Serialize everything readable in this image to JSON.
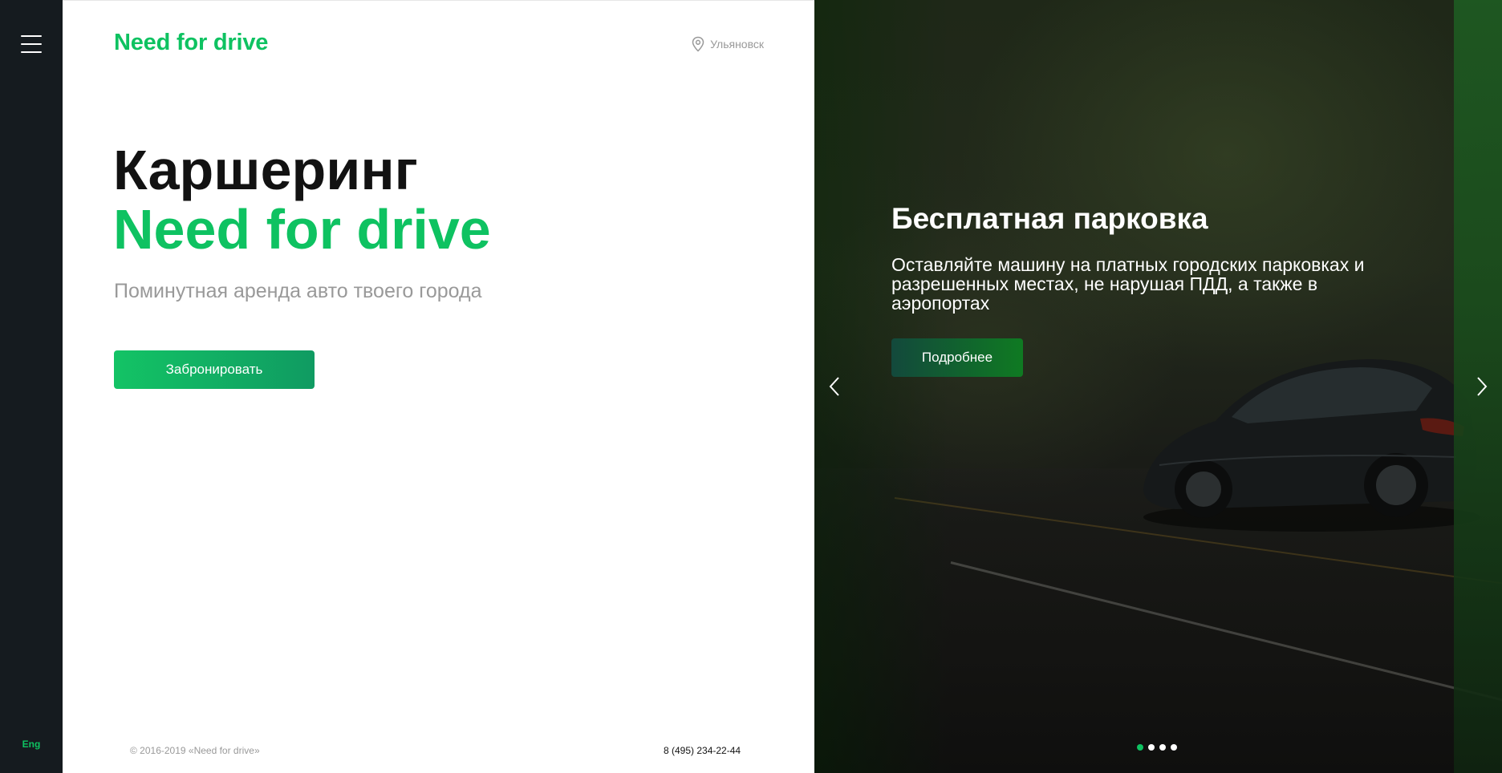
{
  "nav": {
    "menu_icon": "hamburger-menu-icon",
    "language": "Eng"
  },
  "header": {
    "brand": "Need for drive",
    "location_icon": "map-pin-icon",
    "city": "Ульяновск"
  },
  "hero": {
    "title": "Каршеринг",
    "brand": "Need for drive",
    "subtitle": "Поминутная аренда авто твоего города",
    "book_label": "Забронировать"
  },
  "footer": {
    "copyright": "© 2016-2019 «Need for drive»",
    "phone": "8 (495) 234-22-44"
  },
  "slider": {
    "title": "Бесплатная парковка",
    "text": "Оставляйте машину на платных городских парковках и разрешенных местах, не нарушая ПДД, а также в аэропортах",
    "more_label": "Подробнее",
    "prev_icon": "chevron-left-icon",
    "next_icon": "chevron-right-icon",
    "slide_count": 4,
    "active_slide": 1
  },
  "colors": {
    "accent": "#0ec261",
    "rail": "#151b1f",
    "text_dark": "#121212",
    "text_muted": "#999999"
  }
}
